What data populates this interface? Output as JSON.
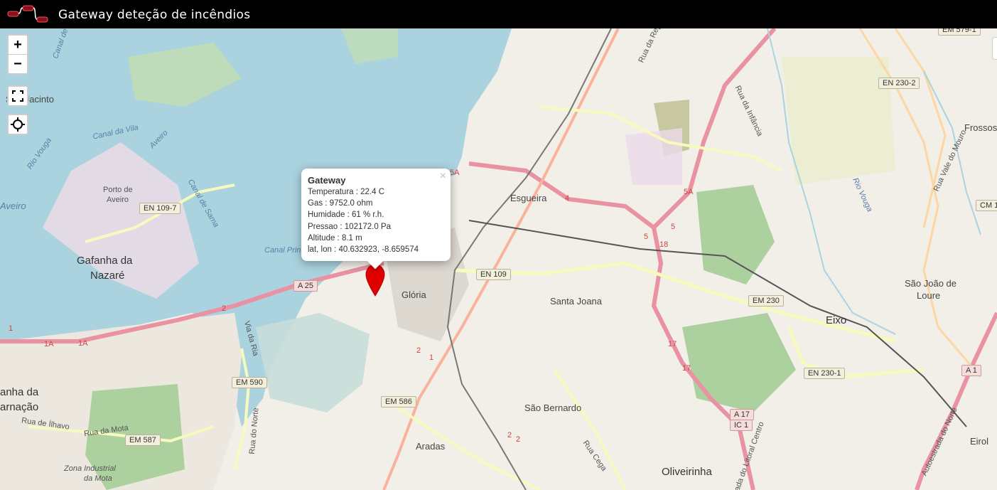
{
  "header": {
    "title": "Gateway deteção de incêndios"
  },
  "controls": {
    "zoom_in": "+",
    "zoom_out": "−",
    "fullscreen": "fullscreen-icon",
    "locate": "crosshair-icon"
  },
  "popup": {
    "title": "Gateway",
    "close": "×",
    "lines": [
      "Temperatura : 22.4 C",
      "Gas : 9752.0 ohm",
      "Humidade : 61 % r.h.",
      "Pressao : 102172.0 Pa",
      "Altitude : 8.1 m",
      "lat, lon : 40.632923, -8.659574"
    ]
  },
  "marker": {
    "color": "#e00000",
    "icon": "map-pin-icon"
  },
  "places": {
    "sao_jacinto": "São Jacinto",
    "porto_aveiro_1": "Porto de",
    "porto_aveiro_2": "Aveiro",
    "gafanha_nazare_1": "Gafanha da",
    "gafanha_nazare_2": "Nazaré",
    "gafanha_encarnacao_1": "anha da",
    "gafanha_encarnacao_2": "arnação",
    "gloria": "Glória",
    "esgueira": "Esgueira",
    "santa_joana": "Santa Joana",
    "eixo": "Eixo",
    "sao_joao_loure_1": "São João de",
    "sao_joao_loure_2": "Loure",
    "frossos": "Frossos",
    "sao_bernardo": "São Bernardo",
    "aradas": "Aradas",
    "oliveirinha": "Oliveirinha",
    "eirol": "Eirol",
    "zona_industrial_1": "Zona Industrial",
    "zona_industrial_2": "da Mota",
    "aveiro_west": "Aveiro"
  },
  "water_labels": {
    "canal_vila": "Canal da Vila",
    "canal_sao_jacinto": "Canal de São Jacinto",
    "rio_vouga": "Rio Vouga",
    "rio_vouga_east": "Rio Vouga",
    "canal_sama": "Canal de Sama",
    "canal_principal": "Canal Prin",
    "aveiro_water": "Aveiro"
  },
  "street_labels": {
    "rua_ilhavo": "Rua de Ílhavo",
    "rua_mota": "Rua da Mota",
    "rua_norte": "Rua do Norte",
    "via_ria": "Via da Ria",
    "rua_infancia": "Rua da Infância",
    "rua_cega": "Rua Cega",
    "autoestrada_norte": "Autoestrada do Norte",
    "estrada_litoral": "Estrada do Litoral Centro",
    "rua_vale_mouro": "Rua Vale do Mouro",
    "rua_repuplica": "Rua da Rep"
  },
  "road_shields": {
    "em5791": "EM 579-1",
    "en2302": "EN 230-2",
    "cm1": "CM 1",
    "en1097": "EN 109-7",
    "a25": "A 25",
    "en109": "EN 109",
    "em230": "EM 230",
    "en2301": "EN 230-1",
    "em590": "EM 590",
    "em586": "EM 586",
    "em587": "EM 587",
    "a17_1": "A 17",
    "a17_2": "IC 1",
    "a1": "A 1"
  },
  "road_numbers": {
    "n5a_1": "5A",
    "n5a_2": "5A",
    "n4": "4",
    "n5_1": "5",
    "n5_2": "5",
    "n18": "18",
    "n17_1": "17",
    "n17_2": "17",
    "n1": "1",
    "n1a_1": "1A",
    "n1a_2": "1A",
    "n2_1": "2",
    "n2_2": "2",
    "n2_3": "2",
    "n2_4": "2",
    "n1b": "1"
  },
  "colors": {
    "water": "#aad3df",
    "land": "#f2efe9",
    "motorway": "#e892a2",
    "trunk": "#f9b29c",
    "primary": "#fcd6a4",
    "secondary": "#f7fabf",
    "forest": "#add19e",
    "grass": "#cdebb0",
    "industrial": "#ebdbe8"
  }
}
